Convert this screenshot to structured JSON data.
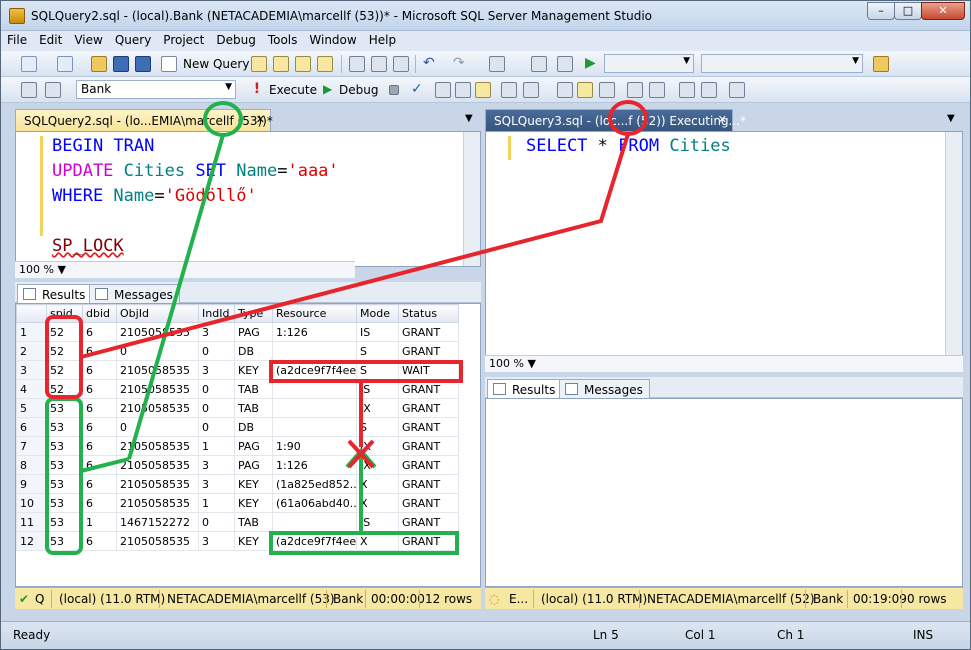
{
  "window": {
    "title": "SQLQuery2.sql - (local).Bank (NETACADEMIA\\marcellf (53))* - Microsoft SQL Server Management Studio",
    "min": "–",
    "max": "□",
    "close": "✕"
  },
  "menu": [
    "File",
    "Edit",
    "View",
    "Query",
    "Project",
    "Debug",
    "Tools",
    "Window",
    "Help"
  ],
  "toolbar": {
    "new_query": "New Query",
    "database": "Bank",
    "execute": "Execute",
    "debug": "Debug",
    "checkmark": "✓"
  },
  "left_pane": {
    "tab_label": "SQLQuery2.sql - (lo...EMIA\\marcellf (53))*",
    "code_lines": [
      {
        "parts": [
          {
            "t": "BEGIN TRAN",
            "c": "kw"
          }
        ]
      },
      {
        "parts": [
          {
            "t": "UPDATE ",
            "c": "kwp"
          },
          {
            "t": "Cities ",
            "c": "obj"
          },
          {
            "t": "SET ",
            "c": "kw"
          },
          {
            "t": "Name",
            "c": "obj"
          },
          {
            "t": "=",
            "c": ""
          },
          {
            "t": "'aaa'",
            "c": "str"
          }
        ]
      },
      {
        "parts": [
          {
            "t": "WHERE ",
            "c": "kw"
          },
          {
            "t": "Name",
            "c": "obj"
          },
          {
            "t": "=",
            "c": ""
          },
          {
            "t": "'Gödöllő'",
            "c": "str"
          }
        ]
      },
      {
        "parts": [
          {
            "t": " ",
            "c": ""
          }
        ]
      },
      {
        "parts": [
          {
            "t": "SP_LOCK",
            "c": "sp"
          }
        ]
      }
    ],
    "zoom": "100 %",
    "results_tab": "Results",
    "messages_tab": "Messages",
    "columns": [
      "",
      "spid",
      "dbid",
      "ObjId",
      "IndId",
      "Type",
      "Resource",
      "Mode",
      "Status"
    ],
    "rows": [
      [
        "1",
        "52",
        "6",
        "2105058535",
        "3",
        "PAG",
        "1:126",
        "IS",
        "GRANT"
      ],
      [
        "2",
        "52",
        "6",
        "0",
        "0",
        "DB",
        "",
        "S",
        "GRANT"
      ],
      [
        "3",
        "52",
        "6",
        "2105058535",
        "3",
        "KEY",
        "(a2dce9f7f4ee)",
        "S",
        "WAIT"
      ],
      [
        "4",
        "52",
        "6",
        "2105058535",
        "0",
        "TAB",
        "",
        "IS",
        "GRANT"
      ],
      [
        "5",
        "53",
        "6",
        "2105058535",
        "0",
        "TAB",
        "",
        "IX",
        "GRANT"
      ],
      [
        "6",
        "53",
        "6",
        "0",
        "0",
        "DB",
        "",
        "S",
        "GRANT"
      ],
      [
        "7",
        "53",
        "6",
        "2105058535",
        "1",
        "PAG",
        "1:90",
        "IX",
        "GRANT"
      ],
      [
        "8",
        "53",
        "6",
        "2105058535",
        "3",
        "PAG",
        "1:126",
        "IX",
        "GRANT"
      ],
      [
        "9",
        "53",
        "6",
        "2105058535",
        "3",
        "KEY",
        "(1a825ed852...",
        "X",
        "GRANT"
      ],
      [
        "10",
        "53",
        "6",
        "2105058535",
        "1",
        "KEY",
        "(61a06abd40...",
        "X",
        "GRANT"
      ],
      [
        "11",
        "53",
        "1",
        "1467152272",
        "0",
        "TAB",
        "",
        "IS",
        "GRANT"
      ],
      [
        "12",
        "53",
        "6",
        "2105058535",
        "3",
        "KEY",
        "(a2dce9f7f4ee)",
        "X",
        "GRANT"
      ]
    ],
    "status": {
      "q": "Q",
      "server": "(local) (11.0 RTM)",
      "user": "NETACADEMIA\\marcellf (53)",
      "db": "Bank",
      "time": "00:00:00",
      "rows": "12 rows"
    }
  },
  "right_pane": {
    "tab_label": "SQLQuery3.sql - (loc...f (52)) Executing...*",
    "code_lines": [
      {
        "parts": [
          {
            "t": "SELECT ",
            "c": "kw"
          },
          {
            "t": "* ",
            "c": ""
          },
          {
            "t": "FROM ",
            "c": "kw"
          },
          {
            "t": "Cities",
            "c": "obj"
          }
        ]
      }
    ],
    "zoom": "100 %",
    "results_tab": "Results",
    "messages_tab": "Messages",
    "status": {
      "q": "E...",
      "server": "(local) (11.0 RTM)",
      "user": "NETACADEMIA\\marcellf (52)",
      "db": "Bank",
      "time": "00:19:09",
      "rows": "0 rows"
    }
  },
  "statusbar": {
    "ready": "Ready",
    "ln": "Ln 5",
    "col": "Col 1",
    "ch": "Ch 1",
    "ins": "INS"
  },
  "colors": {
    "annot_red": "#e8242c",
    "annot_green": "#22b14c",
    "accent": "#36557f"
  }
}
